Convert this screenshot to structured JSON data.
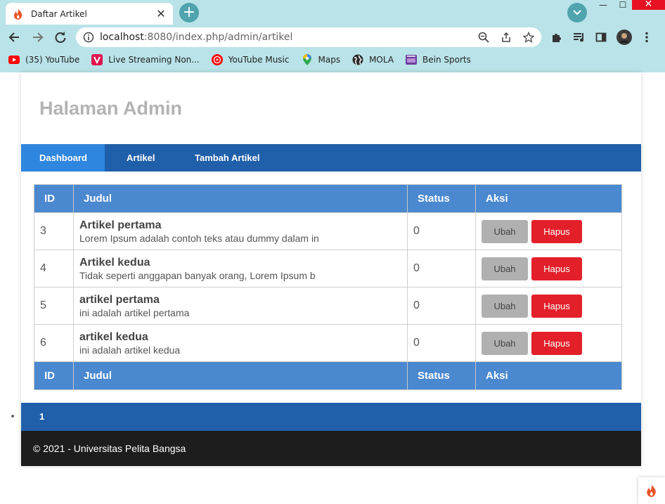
{
  "browser": {
    "tab_title": "Daftar Artikel",
    "tab_close": "✕",
    "new_tab": "+",
    "url_host": "localhost",
    "url_rest": ":8080/index.php/admin/artikel",
    "bookmarks": [
      "(35) YouTube",
      "Live Streaming Non...",
      "YouTube Music",
      "Maps",
      "MOLA",
      "Bein Sports"
    ]
  },
  "header": {
    "title": "Halaman Admin"
  },
  "nav": {
    "items": [
      "Dashboard",
      "Artikel",
      "Tambah Artikel"
    ]
  },
  "table": {
    "headers": [
      "ID",
      "Judul",
      "Status",
      "Aksi"
    ],
    "rows": [
      {
        "id": "3",
        "title": "Artikel pertama",
        "excerpt": "Lorem Ipsum adalah contoh teks atau dummy dalam in",
        "status": "0"
      },
      {
        "id": "4",
        "title": "Artikel kedua",
        "excerpt": "Tidak seperti anggapan banyak orang, Lorem Ipsum b",
        "status": "0"
      },
      {
        "id": "5",
        "title": "artikel pertama",
        "excerpt": "ini adalah artikel pertama",
        "status": "0"
      },
      {
        "id": "6",
        "title": "artikel kedua",
        "excerpt": "ini adalah artikel kedua",
        "status": "0"
      }
    ],
    "edit_label": "Ubah",
    "delete_label": "Hapus"
  },
  "pagination": {
    "current": "1"
  },
  "footer": {
    "text": "© 2021 - Universitas Pelita Bangsa"
  },
  "colors": {
    "nav": "#2060ab",
    "nav_active": "#2f86de",
    "table_head": "#4a88d0",
    "delete": "#e3202a",
    "edit": "#b0b0b0",
    "footer": "#1d1d1d",
    "chrome": "#b9e3e8"
  }
}
